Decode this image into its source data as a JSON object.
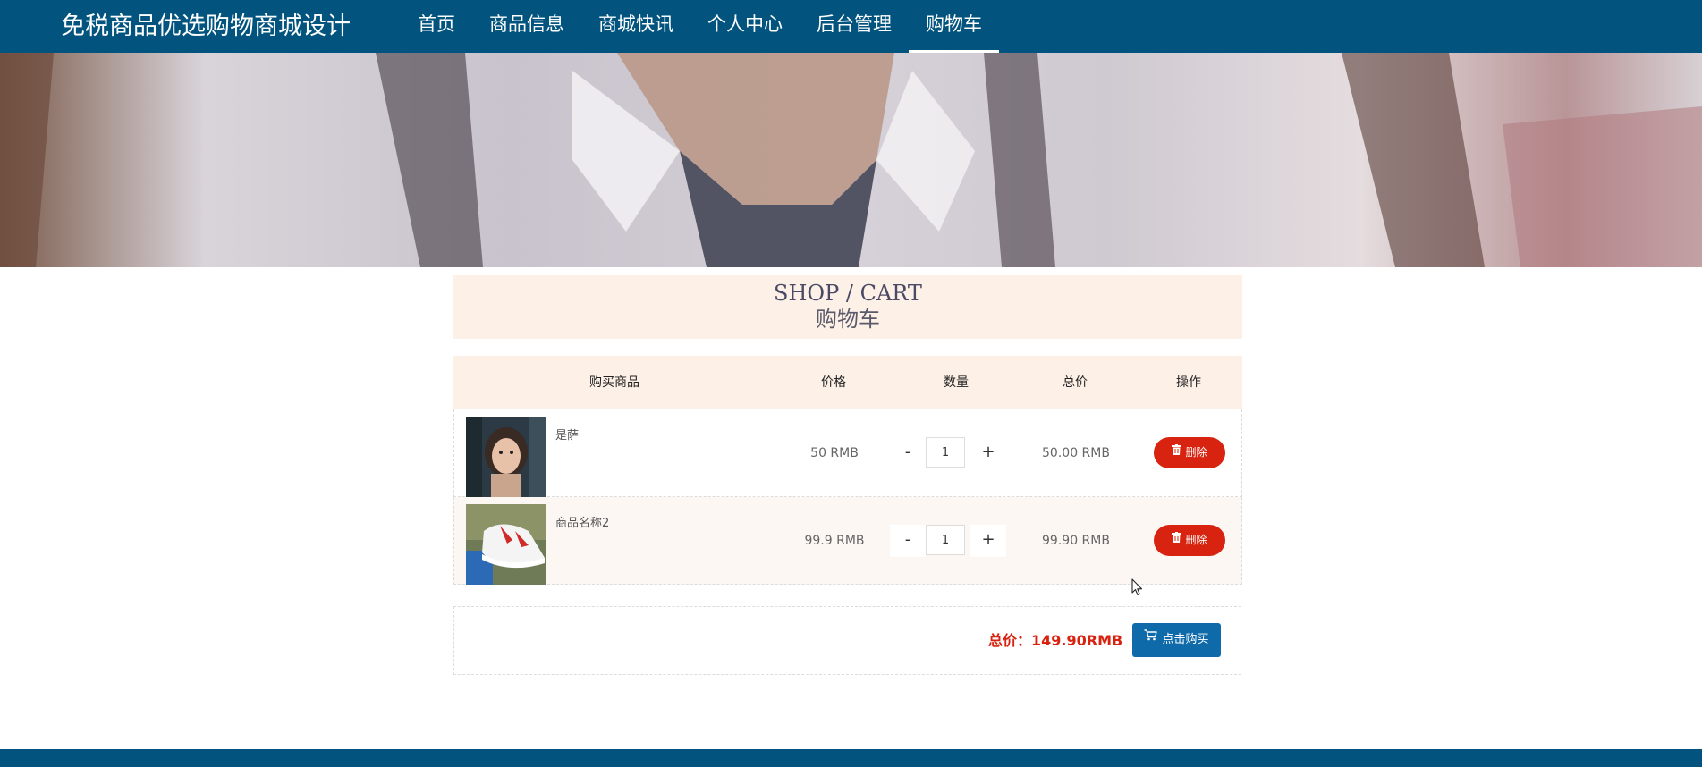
{
  "header": {
    "site_title": "免税商品优选购物商城设计",
    "nav": [
      {
        "label": "首页",
        "active": false
      },
      {
        "label": "商品信息",
        "active": false
      },
      {
        "label": "商城快讯",
        "active": false
      },
      {
        "label": "个人中心",
        "active": false
      },
      {
        "label": "后台管理",
        "active": false
      },
      {
        "label": "购物车",
        "active": true
      }
    ]
  },
  "banner": {
    "dots": 3,
    "active_dot": 0
  },
  "cart": {
    "heading_en": "SHOP / CART",
    "heading_cn": "购物车",
    "columns": [
      "购买商品",
      "价格",
      "数量",
      "总价",
      "操作"
    ],
    "items": [
      {
        "name": "是萨",
        "price": "50 RMB",
        "qty": "1",
        "total": "50.00 RMB",
        "delete_label": "删除",
        "minus": "-",
        "plus": "+"
      },
      {
        "name": "商品名称2",
        "price": "99.9 RMB",
        "qty": "1",
        "total": "99.90 RMB",
        "delete_label": "删除",
        "minus": "-",
        "plus": "+"
      }
    ],
    "total_label": "总价：149.90RMB",
    "buy_label": "点击购买"
  },
  "colors": {
    "primary": "#02547e",
    "danger": "#d7230f",
    "button_blue": "#0e6aa8",
    "heading_bg": "#fdf0e7"
  },
  "icons": {
    "delete": "trash-icon",
    "buy": "cart-icon"
  }
}
